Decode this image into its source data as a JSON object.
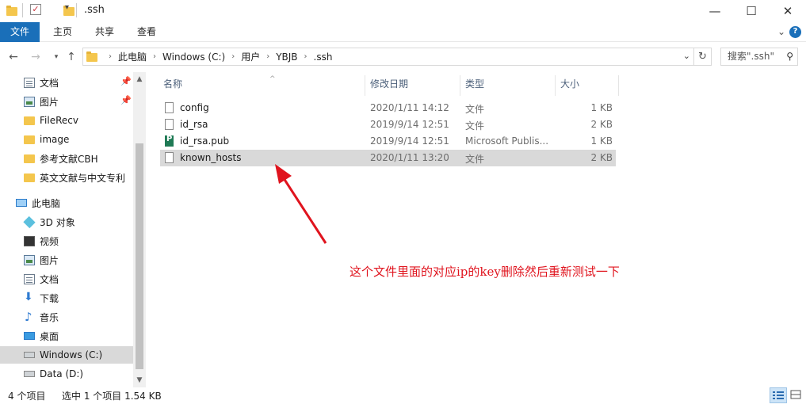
{
  "window": {
    "title": ".ssh",
    "minimize": "—",
    "maximize": "☐",
    "close": "✕"
  },
  "ribbon": {
    "tabs": [
      "文件",
      "主页",
      "共享",
      "查看"
    ],
    "expand": "⌄",
    "help": "?"
  },
  "address": {
    "crumbs": [
      "此电脑",
      "Windows (C:)",
      "用户",
      "YBJB",
      ".ssh"
    ],
    "search_placeholder": "搜索\".ssh\""
  },
  "sidebar": {
    "items": [
      {
        "label": "文档",
        "icon": "document-icon",
        "pinned": true
      },
      {
        "label": "图片",
        "icon": "picture-icon",
        "pinned": true
      },
      {
        "label": "FileRecv",
        "icon": "folder-icon"
      },
      {
        "label": "image",
        "icon": "folder-icon"
      },
      {
        "label": "参考文献CBH",
        "icon": "folder-icon"
      },
      {
        "label": "英文文献与中文专利",
        "icon": "folder-icon"
      },
      {
        "label": "此电脑",
        "icon": "computer-icon"
      },
      {
        "label": "3D 对象",
        "icon": "3d-objects-icon"
      },
      {
        "label": "视频",
        "icon": "video-icon"
      },
      {
        "label": "图片",
        "icon": "picture-icon"
      },
      {
        "label": "文档",
        "icon": "document-icon"
      },
      {
        "label": "下载",
        "icon": "download-icon"
      },
      {
        "label": "音乐",
        "icon": "music-icon"
      },
      {
        "label": "桌面",
        "icon": "desktop-icon"
      },
      {
        "label": "Windows (C:)",
        "icon": "drive-icon",
        "selected": true
      },
      {
        "label": "Data (D:)",
        "icon": "drive-icon"
      }
    ]
  },
  "columns": {
    "name": "名称",
    "date": "修改日期",
    "type": "类型",
    "size": "大小"
  },
  "files": [
    {
      "name": "config",
      "date": "2020/1/11 14:12",
      "type": "文件",
      "size": "1 KB"
    },
    {
      "name": "id_rsa",
      "date": "2019/9/14 12:51",
      "type": "文件",
      "size": "2 KB"
    },
    {
      "name": "id_rsa.pub",
      "date": "2019/9/14 12:51",
      "type": "Microsoft Publis...",
      "size": "1 KB"
    },
    {
      "name": "known_hosts",
      "date": "2020/1/11 13:20",
      "type": "文件",
      "size": "2 KB",
      "selected": true
    }
  ],
  "annotation": {
    "text": "这个文件里面的对应ip的key删除然后重新测试一下",
    "color": "#e0141e"
  },
  "status": {
    "count": "4 个项目",
    "selection": "选中 1 个项目  1.54 KB"
  }
}
